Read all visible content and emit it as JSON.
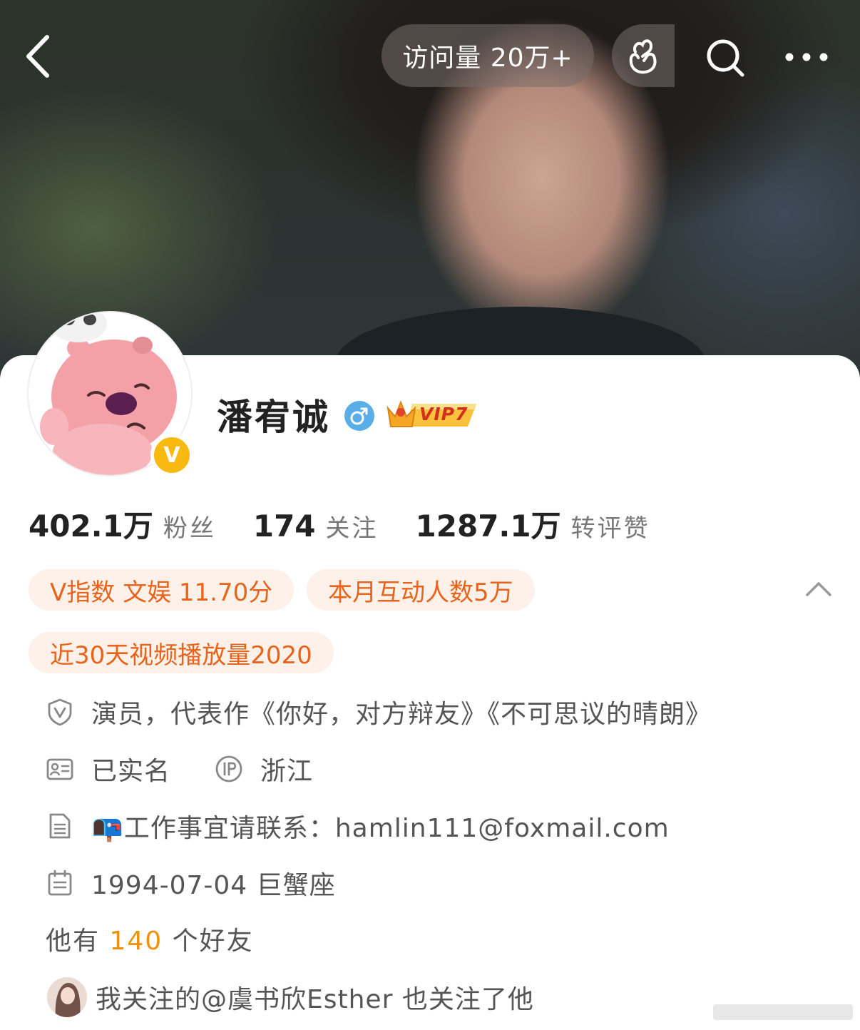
{
  "header": {
    "visit_label": "访问量 20万+",
    "icons": {
      "back": "chevron-left-icon",
      "hand": "finger-heart-icon",
      "search": "search-icon",
      "more": "more-dots-icon"
    }
  },
  "profile": {
    "name": "潘宥诚",
    "gender": "male",
    "vip_label": "VIP7",
    "verified": true,
    "verified_badge": "V"
  },
  "stats": [
    {
      "value": "402.1万",
      "label": "粉丝"
    },
    {
      "value": "174",
      "label": "关注"
    },
    {
      "value": "1287.1万",
      "label": "转评赞"
    }
  ],
  "tags": [
    "V指数 文娱 11.70分",
    "本月互动人数5万",
    "近30天视频播放量2020"
  ],
  "info": {
    "intro": "演员，代表作《你好，对方辩友》《不可思议的晴朗》",
    "realname": "已实名",
    "ip": "浙江",
    "contact": "📭工作事宜请联系：hamlin111@foxmail.com",
    "birthday": "1994-07-04 巨蟹座"
  },
  "friends": {
    "prefix": "他有",
    "count": "140",
    "suffix": "个好友"
  },
  "mutual_follow": "我关注的@虞书欣Esther 也关注了他",
  "colors": {
    "accent": "#e8641a",
    "tag_bg": "#fdf1ea",
    "friend_count": "#f0900f",
    "verified": "#f8b910",
    "gender": "#5aaee8"
  }
}
